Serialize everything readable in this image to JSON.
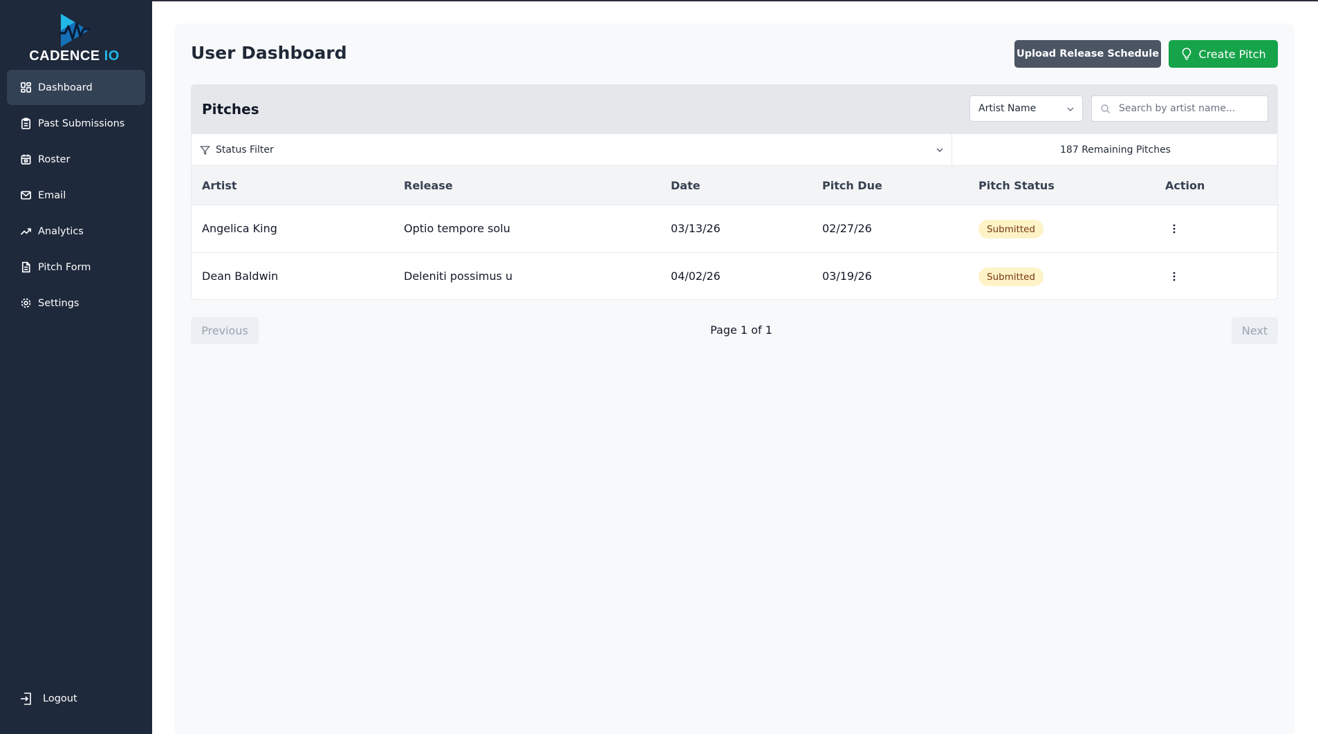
{
  "app": {
    "name_main": "CADENCE ",
    "name_accent": "IO",
    "brand_color": "#22b8e6",
    "sidebar_color": "#1e293b"
  },
  "sidebar": {
    "items": [
      {
        "label": "Dashboard",
        "icon": "dashboard-icon",
        "active": true
      },
      {
        "label": "Past Submissions",
        "icon": "clipboard-icon",
        "active": false
      },
      {
        "label": "Roster",
        "icon": "calendar-icon",
        "active": false
      },
      {
        "label": "Email",
        "icon": "mail-icon",
        "active": false
      },
      {
        "label": "Analytics",
        "icon": "trending-up-icon",
        "active": false
      },
      {
        "label": "Pitch Form",
        "icon": "document-icon",
        "active": false
      },
      {
        "label": "Settings",
        "icon": "gear-icon",
        "active": false
      }
    ],
    "logout_label": "Logout"
  },
  "header": {
    "title": "User Dashboard",
    "upload_label": "Upload Release Schedule",
    "create_label": "Create Pitch",
    "create_color": "#16a34a"
  },
  "pitches": {
    "title": "Pitches",
    "artist_select_value": "Artist Name",
    "search_placeholder": "Search by artist name...",
    "status_filter_label": "Status Filter",
    "remaining_label": "187 Remaining Pitches",
    "columns": [
      "Artist",
      "Release",
      "Date",
      "Pitch Due",
      "Pitch Status",
      "Action"
    ],
    "rows": [
      {
        "artist": "Angelica King",
        "release": "Optio tempore solu",
        "date": "03/13/26",
        "pitch_due": "02/27/26",
        "status": "Submitted"
      },
      {
        "artist": "Dean Baldwin",
        "release": "Deleniti possimus u",
        "date": "04/02/26",
        "pitch_due": "03/19/26",
        "status": "Submitted"
      }
    ]
  },
  "pagination": {
    "previous_label": "Previous",
    "page_label": "Page 1 of 1",
    "next_label": "Next"
  }
}
